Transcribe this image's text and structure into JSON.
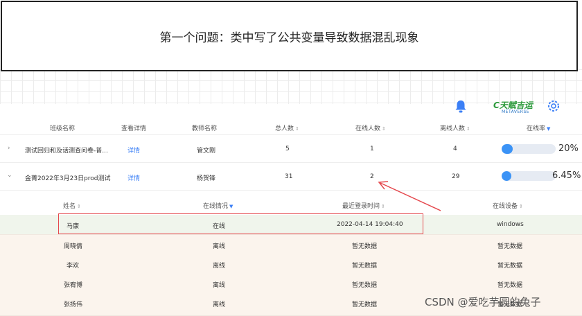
{
  "banner": {
    "text": "第一个问题：类中写了公共变量导致数据混乱现象"
  },
  "logo": {
    "main": "C天赋吉运",
    "sub": "METAVERSE"
  },
  "table": {
    "headers": {
      "class_name": "班级名称",
      "details": "查看详情",
      "teacher": "教师名称",
      "total": "总人数",
      "online": "在线人数",
      "offline": "离线人数",
      "online_rate": "在线率"
    },
    "rows": [
      {
        "name": "测试回归和及话测查问卷-普...",
        "details": "详情",
        "teacher": "管文刚",
        "total": "5",
        "online": "1",
        "offline": "4",
        "rate_label": "20%",
        "rate_value": 0.2
      },
      {
        "name": "金菁2022年3月23日prod测试",
        "details": "详情",
        "teacher": "杨贺锋",
        "total": "31",
        "online": "2",
        "offline": "29",
        "rate_label": "6.45%",
        "rate_value": 0.0645
      }
    ]
  },
  "subtable": {
    "headers": {
      "name": "姓名",
      "status": "在线情况",
      "last_login": "最近登录时间",
      "device": "在线设备"
    },
    "rows": [
      {
        "name": "马康",
        "status": "在线",
        "last_login": "2022-04-14 19:04:40",
        "device": "windows"
      },
      {
        "name": "周晓倩",
        "status": "离线",
        "last_login": "暂无数据",
        "device": "暂无数据"
      },
      {
        "name": "李欢",
        "status": "离线",
        "last_login": "暂无数据",
        "device": "暂无数据"
      },
      {
        "name": "张宥博",
        "status": "离线",
        "last_login": "暂无数据",
        "device": "暂无数据"
      },
      {
        "name": "张扬伟",
        "status": "离线",
        "last_login": "暂无数据",
        "device": "暂无数据"
      }
    ]
  },
  "watermark": {
    "text": "CSDN @爱吃芋圆的兔子"
  },
  "colors": {
    "accent": "#3b7ff6",
    "highlight": "#e5484d",
    "online_row": "#f0f5ec",
    "offline_row": "#fbf4ed"
  }
}
